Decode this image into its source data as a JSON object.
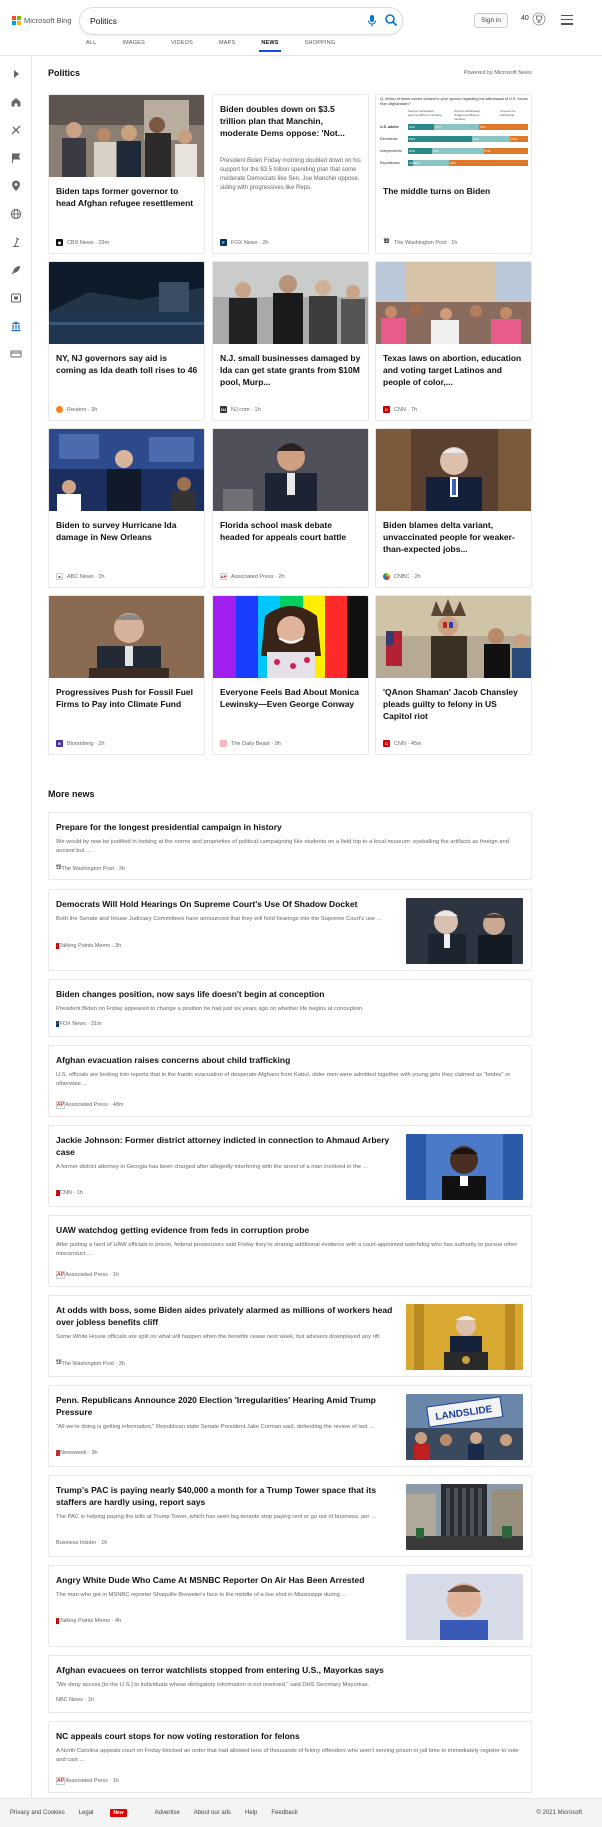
{
  "header": {
    "logo_text": "Microsoft Bing",
    "search_value": "Politics",
    "signin_label": "Sign in",
    "points": "40",
    "tabs": [
      {
        "label": "ALL"
      },
      {
        "label": "IMAGES"
      },
      {
        "label": "VIDEOS"
      },
      {
        "label": "MAPS"
      },
      {
        "label": "NEWS",
        "active": true
      },
      {
        "label": "SHOPPING"
      }
    ]
  },
  "colors": {
    "accent": "#174ae4",
    "search_icon": "#0078d4"
  },
  "section": {
    "title": "Politics",
    "powered_by": "Powered by Microsoft News"
  },
  "top_stories": [
    {
      "title": "Biden taps former governor to head Afghan refugee resettlement",
      "source": "CBS News",
      "age": "29m"
    },
    {
      "title": "Biden doubles down on $3.5 trillion plan that Manchin, moderate Dems oppose: 'Not...",
      "snippet": "President Biden Friday morning doubled down on his support for the $3.5 trillion spending plan that some moderate Democrats like Sen. Joe Manchin oppose, siding with progressives like Reps.",
      "source": "FOX News",
      "age": "2h"
    },
    {
      "title": "The middle turns on Biden",
      "source": "The Washington Post",
      "age": "1h",
      "chart_caption": "Q: Which of these comes closest to your opinion regarding the withdrawal of U.S. forces from Afghanistan?",
      "chart_headers": [
        "Support withdrawal, approve Biden's handling",
        "Support withdrawal, disapprove Biden's handling",
        "Oppose the withdrawal"
      ],
      "chart_rows": [
        {
          "label": "U.S. adults",
          "values": [
            "22%",
            "37%",
            "41%"
          ]
        },
        {
          "label": "Democrats",
          "values": [
            "53%",
            "32%",
            "15%"
          ]
        },
        {
          "label": "Independents",
          "values": [
            "20%",
            "43%",
            "37%"
          ]
        },
        {
          "label": "Republicans",
          "values": [
            "4%",
            "30%",
            "66%"
          ]
        }
      ]
    },
    {
      "title": "NY, NJ governors say aid is coming as Ida death toll rises to 46",
      "source": "Reuters",
      "age": "3h"
    },
    {
      "title": "N.J. small businesses damaged by Ida can get state grants from $10M pool, Murp...",
      "source": "NJ.com",
      "age": "1h"
    },
    {
      "title": "Texas laws on abortion, education and voting target Latinos and people of color,...",
      "source": "CNN",
      "age": "7h"
    },
    {
      "title": "Biden to survey Hurricane Ida damage in New Orleans",
      "source": "ABC News",
      "age": "2h"
    },
    {
      "title": "Florida school mask debate headed for appeals court battle",
      "source": "Associated Press",
      "age": "2h"
    },
    {
      "title": "Biden blames delta variant, unvaccinated people for weaker-than-expected jobs...",
      "source": "CNBC",
      "age": "2h"
    },
    {
      "title": "Progressives Push for Fossil Fuel Firms to Pay into Climate Fund",
      "source": "Bloomberg",
      "age": "2h"
    },
    {
      "title": "Everyone Feels Bad About Monica Lewinsky—Even George Conway",
      "source": "The Daily Beast",
      "age": "9h"
    },
    {
      "title": "'QAnon Shaman' Jacob Chansley pleads guilty to felony in US Capitol riot",
      "source": "CNN",
      "age": "45m"
    }
  ],
  "more_news_title": "More news",
  "more_news": [
    {
      "title": "Prepare for the longest presidential campaign in history",
      "snippet": "We would by now be justified in looking at the norms and proprieties of political campaigning like students on a field trip to a local museum: eyeballing the artifacts as foreign and ancient but ...",
      "source": "The Washington Post",
      "age": "3h"
    },
    {
      "title": "Democrats Will Hold Hearings On Supreme Court's Use Of Shadow Docket",
      "snippet": "Both the Senate and House Judiciary Committees have announced that they will hold hearings into the Supreme Court's use ...",
      "source": "Talking Points Memo",
      "age": "3h"
    },
    {
      "title": "Biden changes position, now says life doesn't begin at conception",
      "snippet": "President Biden on Friday appeared to change a position he had just six years ago on whether life begins at conception.",
      "source": "FOX News",
      "age": "31m"
    },
    {
      "title": "Afghan evacuation raises concerns about child trafficking",
      "snippet": "U.S. officials are looking into reports that in the frantic evacuation of desperate Afghans from Kabul, older men were admitted together with young girls they claimed as “brides” or otherwise ...",
      "source": "Associated Press",
      "age": "48m"
    },
    {
      "title": "Jackie Johnson: Former district attorney indicted in connection to Ahmaud Arbery case",
      "snippet": "A former district attorney in Georgia has been charged after allegedly interfering with the arrest of a man involved in the ...",
      "source": "CNN",
      "age": "1h"
    },
    {
      "title": "UAW watchdog getting evidence from feds in corruption probe",
      "snippet": "After putting a herd of UAW officials in prison, federal prosecutors said Friday they're sharing additional evidence with a court-appointed watchdog who has authority to pursue other misconduct ...",
      "source": "Associated Press",
      "age": "1h"
    },
    {
      "title": "At odds with boss, some Biden aides privately alarmed as millions of workers head over jobless benefits cliff",
      "snippet": "Some White House officials are split on what will happen when the benefits cease next week, but advisers downplayed any rift.",
      "source": "The Washington Post",
      "age": "3h"
    },
    {
      "title": "Penn. Republicans Announce 2020 Election 'Irregularities' Hearing Amid Trump Pressure",
      "snippet": "\"All we're doing is getting information,\" Republican state Senate President Jake Corman said, defending the review of last ...",
      "source": "Newsweek",
      "age": "3h",
      "image_text": "LANDSLIDE"
    },
    {
      "title": "Trump's PAC is paying nearly $40,000 a month for a Trump Tower space that its staffers are hardly using, report says",
      "snippet": "The PAC is helping paying the bills at Trump Tower, which has seen big tenants stop paying rent or go out of business, per ...",
      "source": "Business Insider",
      "age": "1h"
    },
    {
      "title": "Angry White Dude Who Came At MSNBC Reporter On Air Has Been Arrested",
      "snippet": "The man who got in MSNBC reporter Shaquille Brewster's face in the middle of a live shot in Mississippi during ...",
      "source": "Talking Points Memo",
      "age": "4h"
    },
    {
      "title": "Afghan evacuees on terror watchlists stopped from entering U.S., Mayorkas says",
      "snippet": "\"We deny access [to the U.S.] to individuals whose derogatory information is not resolved,\" said DHS Secretary Mayorkas.",
      "source": "NBC News",
      "age": "1h"
    },
    {
      "title": "NC appeals court stops for now voting restoration for felons",
      "snippet": "A North Carolina appeals court on Friday blocked an order that had allowed tens of thousands of felony offenders who aren't serving prison or jail time to immediately register to vote and cast ...",
      "source": "Associated Press",
      "age": "1h"
    }
  ],
  "footer": {
    "links": [
      "Privacy and Cookies",
      "Legal",
      "Advertise",
      "About our ads",
      "Help",
      "Feedback"
    ],
    "legal_badge": "New",
    "copyright": "© 2021 Microsoft"
  }
}
